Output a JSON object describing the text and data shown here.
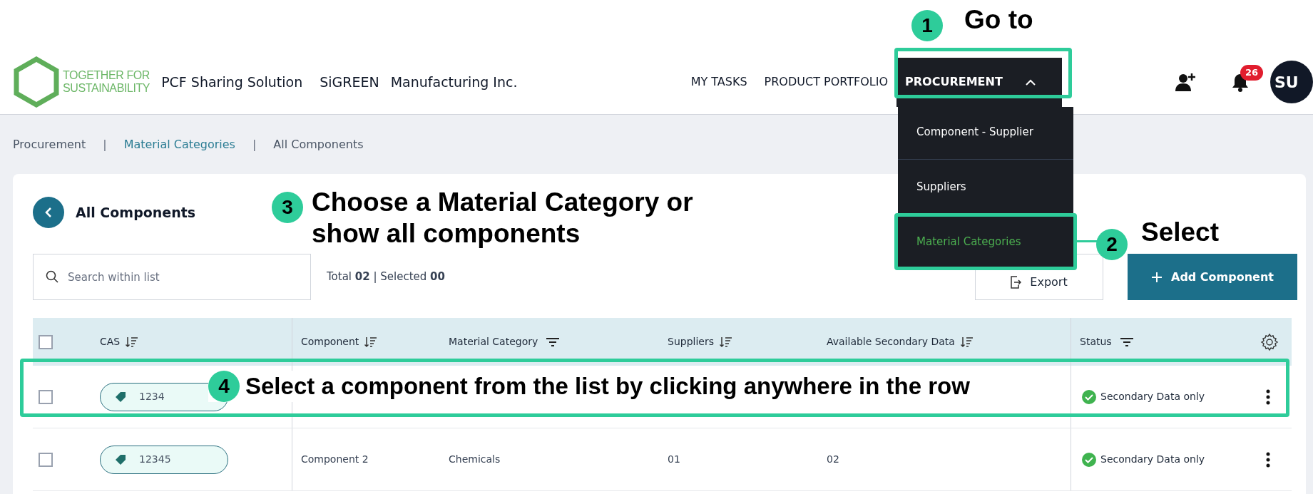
{
  "header": {
    "logo_text": [
      "TOGETHER FOR",
      "SUSTAINABILITY"
    ],
    "app_name": "PCF Sharing Solution",
    "brand": "SiGREEN",
    "company": "Manufacturing Inc.",
    "nav": [
      {
        "label": "MY TASKS",
        "selected": false,
        "expanded": false
      },
      {
        "label": "PRODUCT PORTFOLIO",
        "selected": false,
        "expanded": false
      },
      {
        "label": "PROCUREMENT",
        "selected": true,
        "expanded": true
      }
    ],
    "notification_count": "26",
    "avatar": "SU"
  },
  "nav_menu": [
    {
      "label": "Component - Supplier",
      "selected": false
    },
    {
      "label": "Suppliers",
      "selected": false
    },
    {
      "label": "Material Categories",
      "selected": true
    }
  ],
  "breadcrumb": {
    "items": [
      {
        "label": "Procurement",
        "link": false
      },
      {
        "label": "Material Categories",
        "link": true
      },
      {
        "label": "All Components",
        "link": false
      }
    ],
    "separators": [
      "|",
      "|"
    ]
  },
  "page": {
    "title": "All Components",
    "search_placeholder": "Search within list",
    "counts": "Total **02** | Selected **00**",
    "export": "Export",
    "add": "Add Component"
  },
  "table": {
    "all_checked": false,
    "columns": [
      {
        "label": "CAS",
        "kind": "sort"
      },
      {
        "label": "Component",
        "kind": "sort"
      },
      {
        "label": "Material Category",
        "kind": "filter"
      },
      {
        "label": "Suppliers",
        "kind": "sort"
      },
      {
        "label": "Available Secondary Data",
        "kind": "sort"
      },
      {
        "label": "Status",
        "kind": "filter"
      }
    ],
    "rows": [
      {
        "checked": false,
        "cas": "1234",
        "status": "Secondary Data only"
      },
      {
        "checked": false,
        "cas": "12345",
        "component": "Component 2",
        "material_category": "Chemicals",
        "suppliers": "01",
        "secondary_data": "02",
        "status": "Secondary Data only"
      }
    ]
  },
  "annotations": [
    {
      "number": "1",
      "text": "Go to"
    },
    {
      "number": "3",
      "text": "Choose a Material Category or show all components"
    },
    {
      "number": "2",
      "text": "Select"
    },
    {
      "number": "4",
      "text": "Select a component from the list by clicking anywhere in the row"
    }
  ]
}
